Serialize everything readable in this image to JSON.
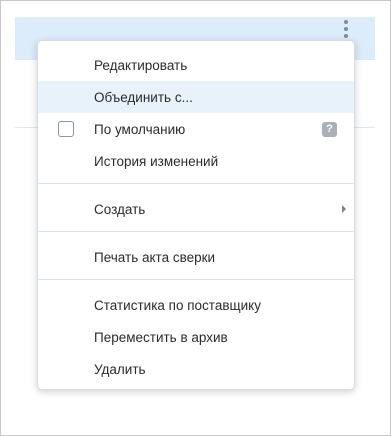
{
  "menu": {
    "edit": "Редактировать",
    "merge": "Объединить с...",
    "default": "По умолчанию",
    "history": "История изменений",
    "create": "Создать",
    "print": "Печать акта сверки",
    "stats": "Статистика по поставщику",
    "archive": "Переместить в архив",
    "delete": "Удалить",
    "help_glyph": "?"
  },
  "icons": {
    "kebab": "more-vertical-icon",
    "help": "question-icon",
    "submenu": "chevron-right-icon"
  },
  "colors": {
    "selected_row": "#dcecfb",
    "highlight": "#e8f2fb"
  }
}
